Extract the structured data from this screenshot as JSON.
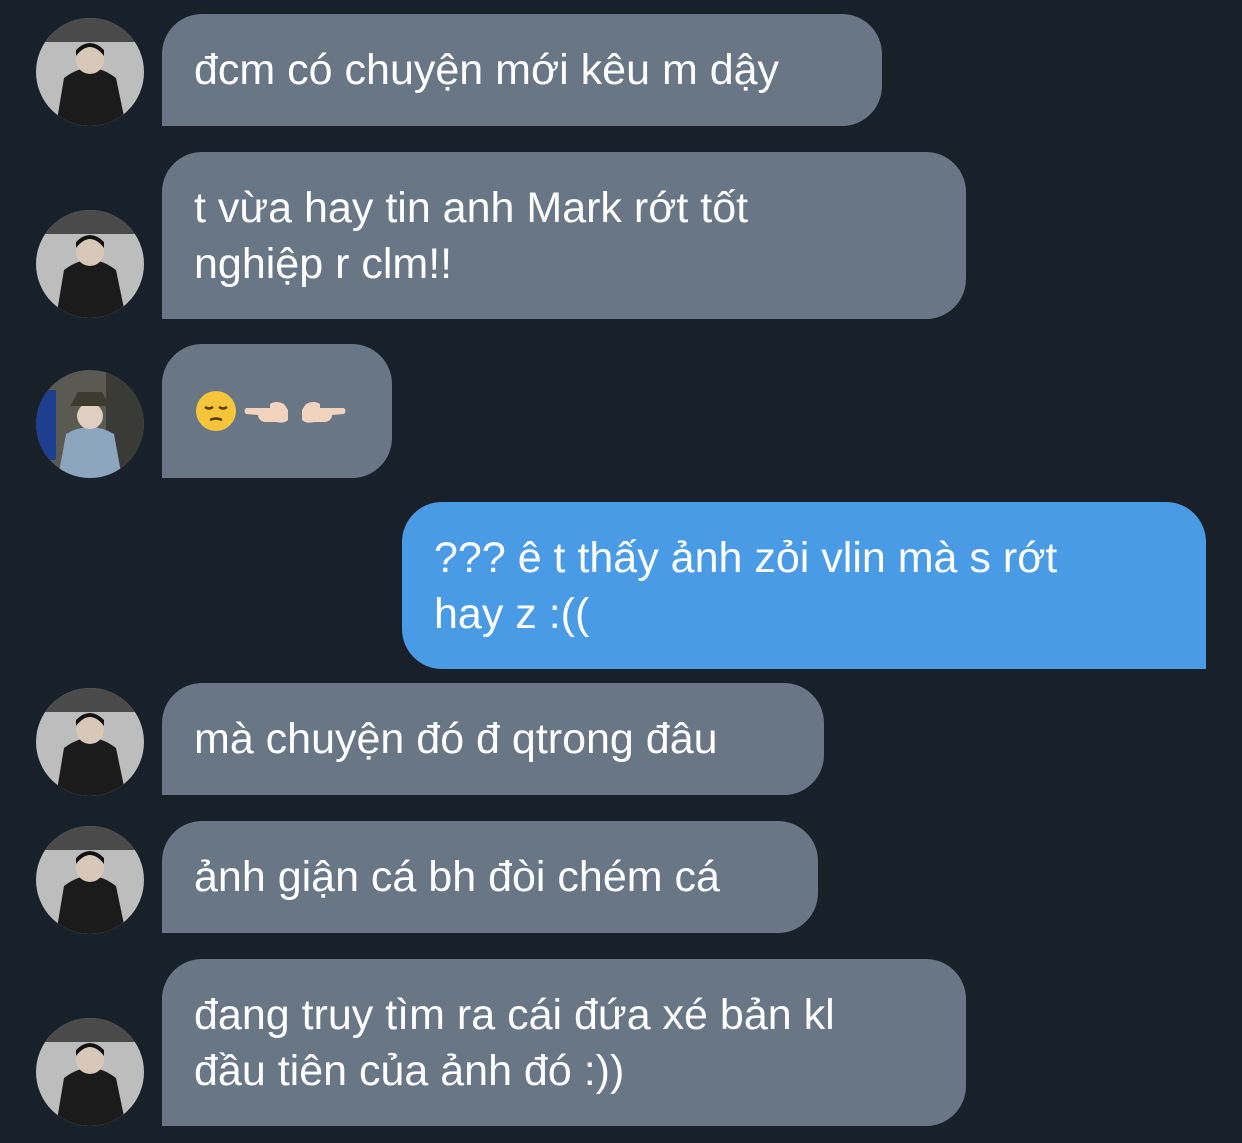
{
  "messages": [
    {
      "side": "in",
      "avatar": "avatar-a",
      "text": "đcm có chuyện mới kêu m dậy"
    },
    {
      "side": "in",
      "avatar": "avatar-a",
      "text": "t vừa hay tin anh Mark rớt tốt\nnghiệp r clm!!"
    },
    {
      "side": "in",
      "avatar": "avatar-b",
      "emojis": [
        "pensive-face",
        "backhand-index-left",
        "backhand-index-right"
      ]
    },
    {
      "side": "out",
      "text": "??? ê t thấy ảnh zỏi vlin mà s rớt\nhay z :(("
    },
    {
      "side": "in",
      "avatar": "avatar-a",
      "text": "mà chuyện đó đ qtrong đâu"
    },
    {
      "side": "in",
      "avatar": "avatar-a",
      "text": "ảnh giận cá bh đòi chém cá"
    },
    {
      "side": "in",
      "avatar": "avatar-a",
      "text": "đang truy tìm ra cái đứa xé bản kl\nđầu tiên của ảnh đó :))"
    }
  ],
  "colors": {
    "background": "#182029",
    "incoming": "#697685",
    "outgoing": "#4a9be6",
    "text": "#ffffff"
  }
}
